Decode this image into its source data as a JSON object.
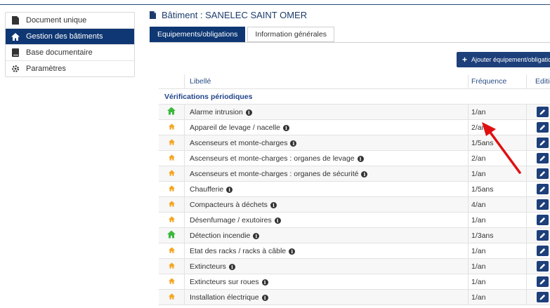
{
  "sidebar": {
    "items": [
      {
        "label": "Document unique",
        "icon": "file-icon",
        "active": false
      },
      {
        "label": "Gestion des bâtiments",
        "icon": "home-icon",
        "active": true
      },
      {
        "label": "Base documentaire",
        "icon": "book-icon",
        "active": false
      },
      {
        "label": "Paramètres",
        "icon": "gear-icon",
        "active": false
      }
    ]
  },
  "header": {
    "title": "Bâtiment : SANELEC SAINT OMER"
  },
  "tabs": [
    {
      "label": "Equipements/obligations",
      "active": true
    },
    {
      "label": "Information générales",
      "active": false
    }
  ],
  "add_button": {
    "label": "Ajouter équipement/obligation"
  },
  "table": {
    "headers": {
      "libelle": "Libellé",
      "frequence": "Fréquence",
      "edition": "Edition"
    },
    "group": "Vérifications périodiques",
    "rows": [
      {
        "label": "Alarme intrusion",
        "freq": "1/an",
        "status": "green"
      },
      {
        "label": "Appareil de levage / nacelle",
        "freq": "2/an",
        "status": "orange"
      },
      {
        "label": "Ascenseurs et monte-charges",
        "freq": "1/5ans",
        "status": "orange"
      },
      {
        "label": "Ascenseurs et monte-charges : organes de levage",
        "freq": "2/an",
        "status": "orange"
      },
      {
        "label": "Ascenseurs et monte-charges : organes de sécurité",
        "freq": "1/an",
        "status": "orange"
      },
      {
        "label": "Chaufferie",
        "freq": "1/5ans",
        "status": "orange"
      },
      {
        "label": "Compacteurs à déchets",
        "freq": "4/an",
        "status": "orange"
      },
      {
        "label": "Désenfumage / exutoires",
        "freq": "1/an",
        "status": "orange"
      },
      {
        "label": "Détection incendie",
        "freq": "1/3ans",
        "status": "green"
      },
      {
        "label": "Etat des racks / racks à câble",
        "freq": "1/an",
        "status": "orange"
      },
      {
        "label": "Extincteurs",
        "freq": "1/an",
        "status": "orange"
      },
      {
        "label": "Extincteurs sur roues",
        "freq": "1/an",
        "status": "orange"
      },
      {
        "label": "Installation électrique",
        "freq": "1/an",
        "status": "orange"
      }
    ]
  },
  "colors": {
    "primary": "#0e3773",
    "green": "#3cb83c",
    "orange": "#f5a623",
    "arrow": "#e01010"
  }
}
